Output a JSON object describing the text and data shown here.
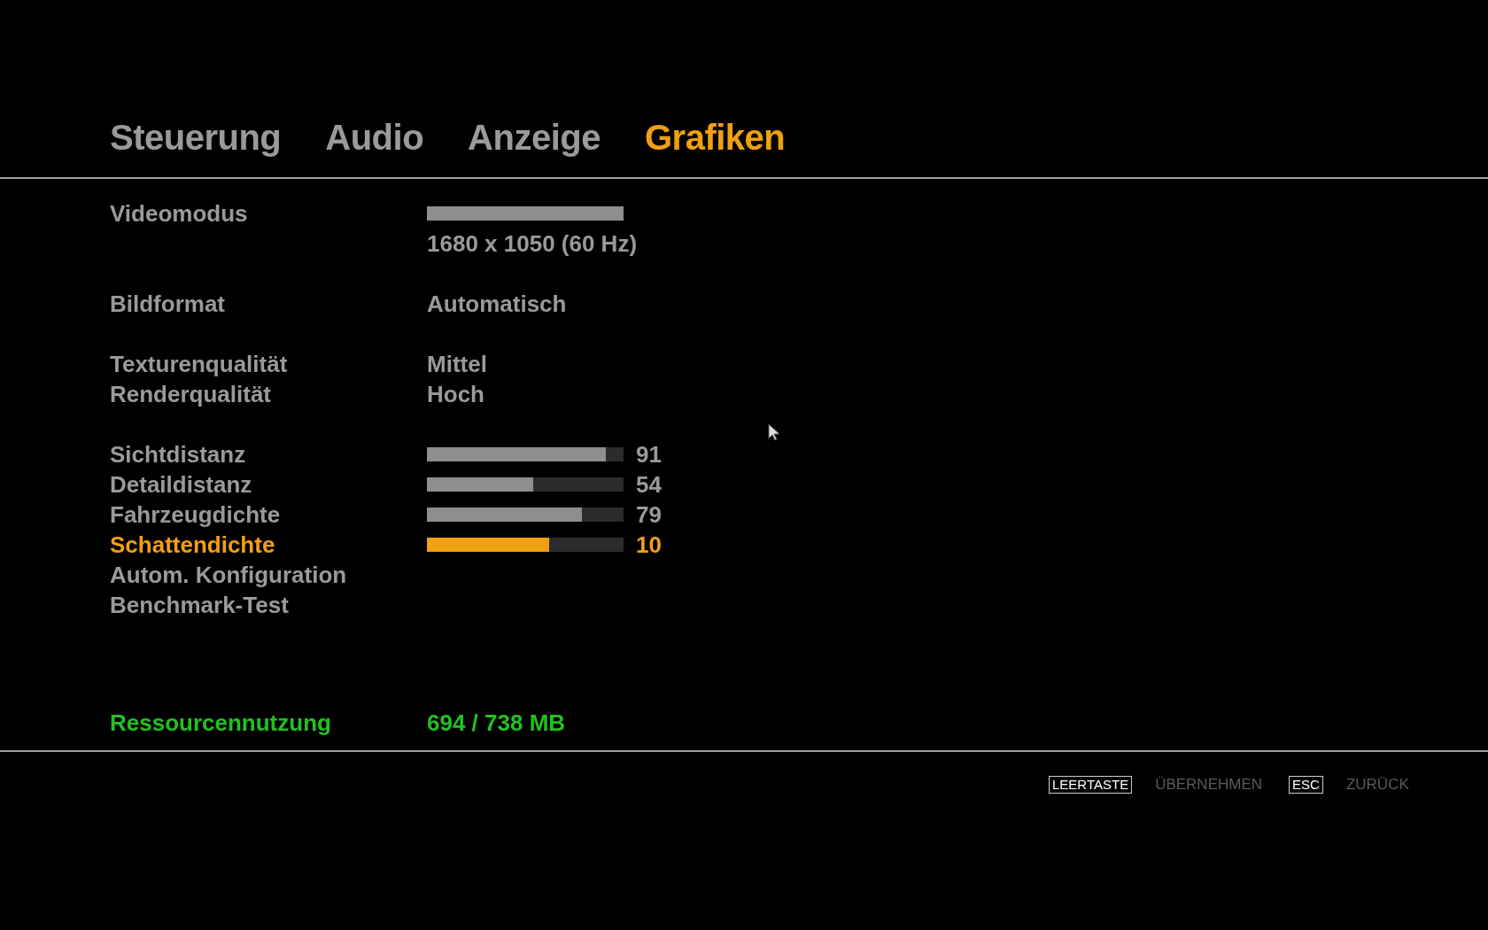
{
  "tabs": [
    {
      "label": "Steuerung",
      "selected": false
    },
    {
      "label": "Audio",
      "selected": false
    },
    {
      "label": "Anzeige",
      "selected": false
    },
    {
      "label": "Grafiken",
      "selected": true
    }
  ],
  "groups": [
    [
      {
        "kind": "videomode",
        "label": "Videomodus",
        "level": 1,
        "value": "1680 x 1050 (60 Hz)",
        "selected": false
      }
    ],
    [
      {
        "kind": "choice",
        "label": "Bildformat",
        "value": "Automatisch",
        "selected": false
      }
    ],
    [
      {
        "kind": "choice",
        "label": "Texturenqualität",
        "value": "Mittel",
        "selected": false
      },
      {
        "kind": "choice",
        "label": "Renderqualität",
        "value": "Hoch",
        "selected": false
      }
    ],
    [
      {
        "kind": "slider",
        "label": "Sichtdistanz",
        "level": 0.91,
        "value": "91",
        "selected": false
      },
      {
        "kind": "slider",
        "label": "Detaildistanz",
        "level": 0.54,
        "value": "54",
        "selected": false
      },
      {
        "kind": "slider",
        "label": "Fahrzeugdichte",
        "level": 0.79,
        "value": "79",
        "selected": false
      },
      {
        "kind": "slider",
        "label": "Schattendichte",
        "level": 0.62,
        "value": "10",
        "selected": true
      },
      {
        "kind": "action",
        "label": "Autom. Konfiguration",
        "selected": false
      },
      {
        "kind": "action",
        "label": "Benchmark-Test",
        "selected": false
      }
    ]
  ],
  "resource": {
    "label": "Ressourcennutzung",
    "value": "694 / 738 MB"
  },
  "footer": [
    {
      "key": "LEERTASTE",
      "action": "ÜBERNEHMEN"
    },
    {
      "key": "ESC",
      "action": "ZURÜCK"
    }
  ]
}
